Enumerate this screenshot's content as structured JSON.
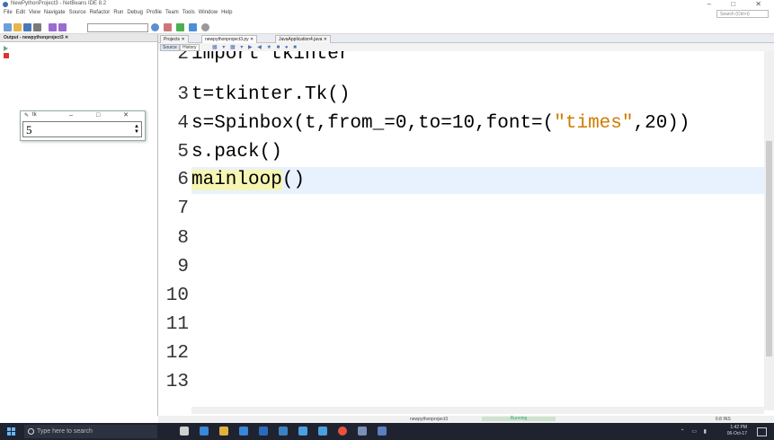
{
  "window": {
    "title": "NewPythonProject3 - NetBeans IDE 8.2",
    "controls": "–  □  ✕"
  },
  "menu": [
    "File",
    "Edit",
    "View",
    "Navigate",
    "Source",
    "Refactor",
    "Run",
    "Debug",
    "Profile",
    "Team",
    "Tools",
    "Window",
    "Help"
  ],
  "search": {
    "placeholder": "Search (Ctrl+I)"
  },
  "output_panel": {
    "tab_label": "Output - newpythonproject3  ✕"
  },
  "tk_window": {
    "title": "tk",
    "controls": "– □ ✕",
    "spinbox_value": "5"
  },
  "editor": {
    "tabs": [
      {
        "label": "Projects  ✕"
      },
      {
        "label": "newpythonproject3.py  ✕"
      },
      {
        "label": "JavaApplication4.java  ✕"
      }
    ],
    "toolbar": {
      "source_label": "Source",
      "history_label": "History"
    },
    "lines": [
      {
        "num": "2",
        "text": "import tkinter"
      },
      {
        "num": "3",
        "text": "t=tkinter.Tk()"
      },
      {
        "num": "4",
        "text_a": "s=Spinbox(t,from_=0,to=10,font=(",
        "string": "\"times\"",
        "text_b": ",20))"
      },
      {
        "num": "5",
        "text": "s.pack()"
      },
      {
        "num": "6",
        "word": "mainloop",
        "rest": "()"
      },
      {
        "num": "7"
      },
      {
        "num": "8"
      },
      {
        "num": "9"
      },
      {
        "num": "10"
      },
      {
        "num": "11"
      },
      {
        "num": "12"
      },
      {
        "num": "13"
      }
    ]
  },
  "status": {
    "project": "newpythonproject3",
    "running": "Running",
    "position": "6:8",
    "mode": "INS"
  },
  "taskbar": {
    "search_placeholder": "Type here to search",
    "time": "1:42 PM",
    "date": "06-Oct-17"
  },
  "colors": {
    "highlight_line": "#e8f2fe",
    "highlight_word": "#f6f5b4",
    "string": "#ce7b00",
    "taskbar": "#1f2330"
  }
}
